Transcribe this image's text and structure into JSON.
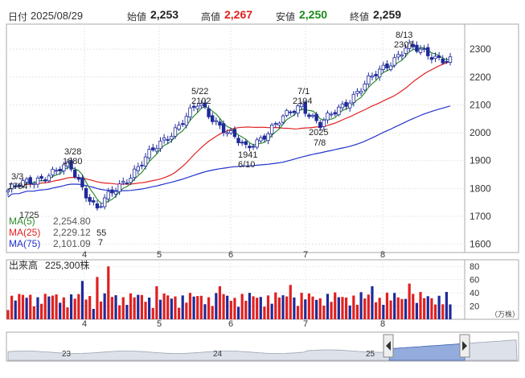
{
  "header": {
    "date_label": "日付",
    "date_value": "2025/08/29",
    "open_label": "始値",
    "open_value": "2,253",
    "high_label": "高値",
    "high_value": "2,267",
    "low_label": "安値",
    "low_value": "2,250",
    "close_label": "終値",
    "close_value": "2,259"
  },
  "colors": {
    "up_candle": "#1e2a9a",
    "down_candle": "#ffffff",
    "high_value": "#e02020",
    "low_value": "#1a8a1a",
    "ma5": "#2e8b2e",
    "ma25": "#e02020",
    "ma75": "#2233cc",
    "volume_red": "#e02020",
    "volume_blue": "#1e2a9a",
    "navigator_fill": "#7a9ad8"
  },
  "price_axis": {
    "ticks": [
      "2300",
      "2200",
      "2100",
      "2000",
      "1900",
      "1800",
      "1700",
      "1600"
    ],
    "range": [
      1570,
      2390
    ]
  },
  "month_labels": [
    "4",
    "5",
    "6",
    "7",
    "8"
  ],
  "annotations": [
    {
      "date": "3/3",
      "value": "1794"
    },
    {
      "date": "3/28",
      "value": "1880"
    },
    {
      "date": "",
      "value": "1725"
    },
    {
      "date": "5/22",
      "value": "2102"
    },
    {
      "date": "6/10",
      "value": "1941"
    },
    {
      "date": "7/1",
      "value": "2104"
    },
    {
      "date": "7/8",
      "value": "2025"
    },
    {
      "date": "8/13",
      "value": "2307"
    },
    {
      "date": "",
      "value": "55"
    },
    {
      "date": "",
      "value": "7"
    }
  ],
  "legend": [
    {
      "label": "MA(5)",
      "value": "2,254.80"
    },
    {
      "label": "MA(25)",
      "value": "2,229.12"
    },
    {
      "label": "MA(75)",
      "value": "2,101.09"
    }
  ],
  "volume": {
    "label": "出来高",
    "value": "225,300株",
    "ticks": [
      "80",
      "60",
      "40",
      "20"
    ],
    "unit": "（万株）"
  },
  "navigator": {
    "year_labels": [
      "23",
      "24",
      "25"
    ]
  },
  "chart_data": {
    "type": "candlestick",
    "period": "2025/03/03 - 2025/08/29",
    "y_range": [
      1570,
      2390
    ],
    "key_points": [
      {
        "date": "3/3",
        "price": 1794
      },
      {
        "date": "3/28",
        "price": 1880
      },
      {
        "date": "4/7",
        "price": 1725
      },
      {
        "date": "5/22",
        "price": 2102
      },
      {
        "date": "6/10",
        "price": 1941
      },
      {
        "date": "7/1",
        "price": 2104
      },
      {
        "date": "7/8",
        "price": 2025
      },
      {
        "date": "8/13",
        "price": 2307
      },
      {
        "date": "8/29",
        "price": 2259
      }
    ],
    "volume_range": [
      0,
      90
    ],
    "last_volume_man_shares": 22.53
  }
}
